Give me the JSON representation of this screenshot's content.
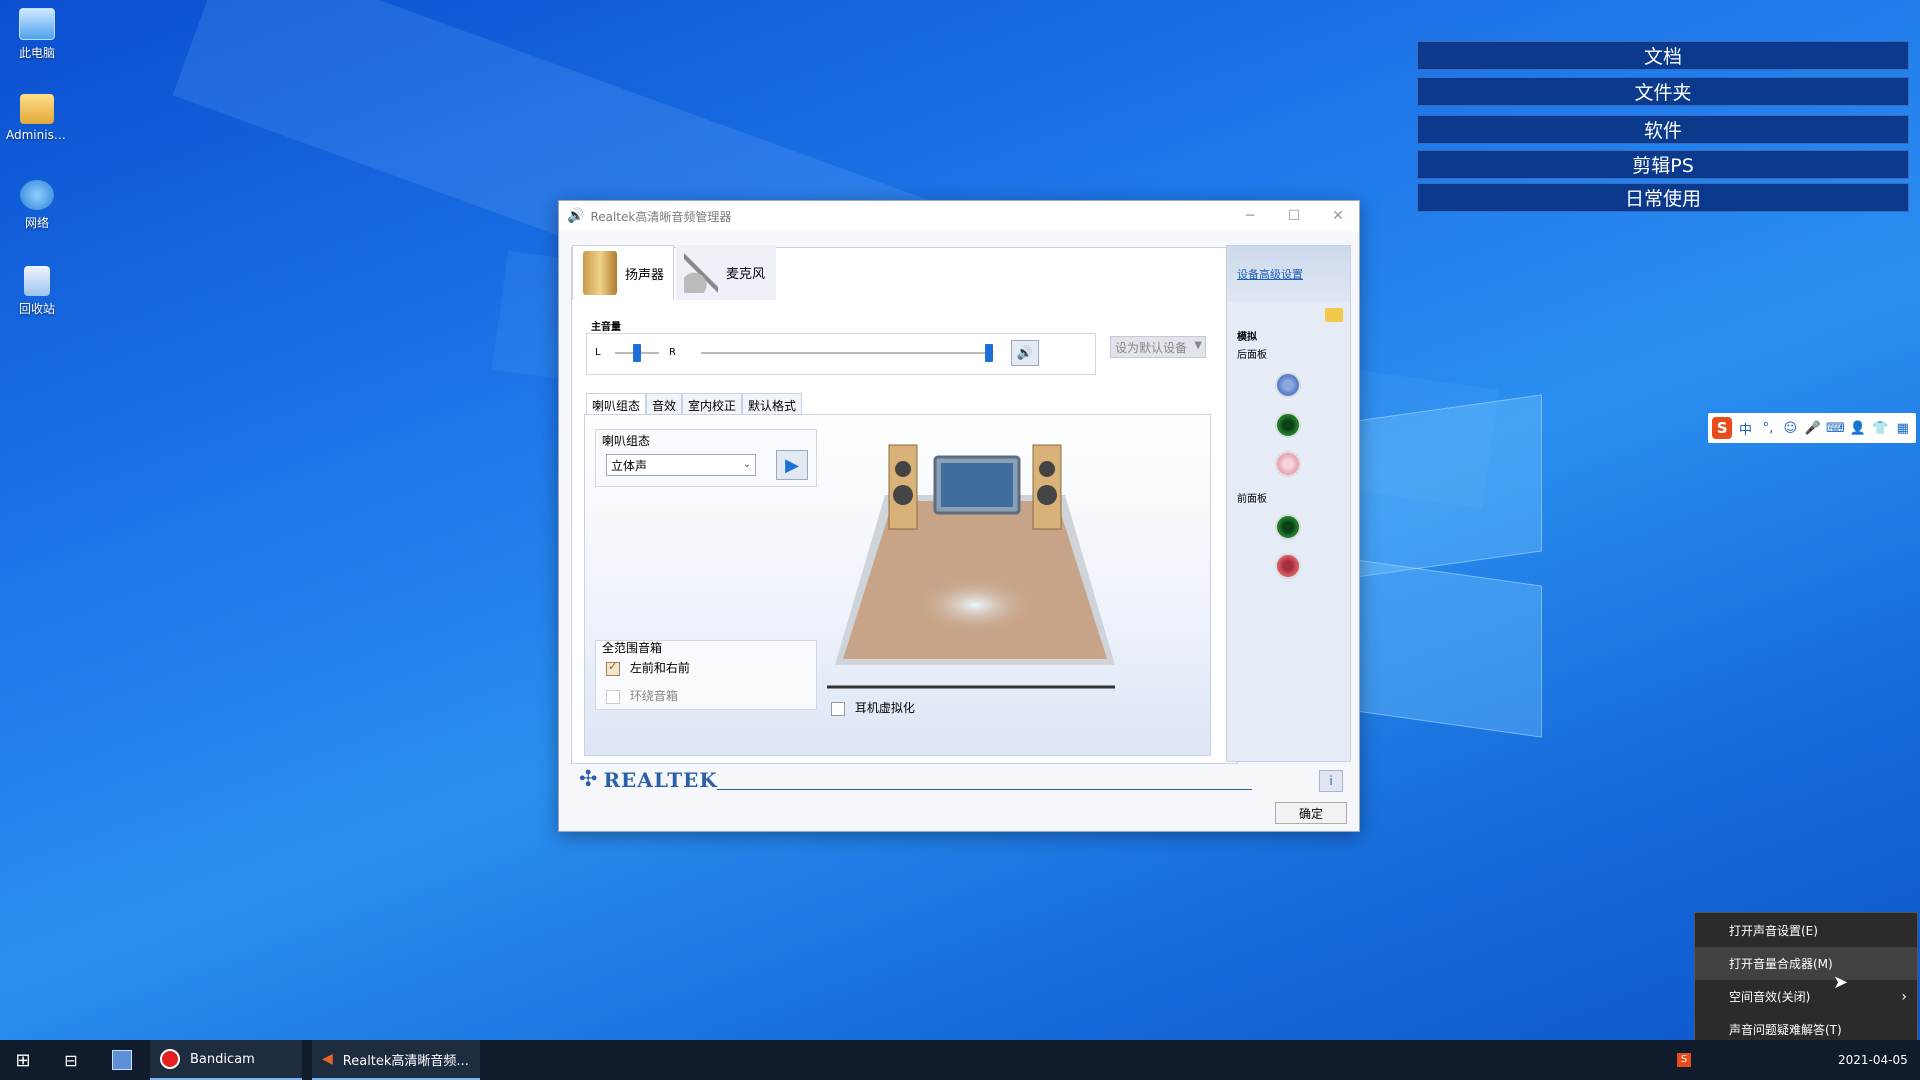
{
  "desktop": {
    "icons": [
      {
        "label": "此电脑",
        "icon": "computer-icon"
      },
      {
        "label": "Administr...",
        "icon": "user-folder-icon"
      },
      {
        "label": "网络",
        "icon": "network-icon"
      },
      {
        "label": "回收站",
        "icon": "recycle-bin-icon"
      }
    ],
    "fences": [
      "文档",
      "文件夹",
      "软件",
      "剪辑PS",
      "日常使用"
    ]
  },
  "ime": {
    "logo": "S",
    "items": [
      "中",
      "°,",
      "☺",
      "🎤",
      "⌨",
      "👤",
      "👕",
      "▦"
    ]
  },
  "realtek": {
    "title": "Realtek高清晰音频管理器",
    "device_tabs": [
      "扬声器",
      "麦克风"
    ],
    "main_volume_label": "主音量",
    "balance_left": "L",
    "balance_right": "R",
    "default_device_label": "设为默认设备",
    "sub_tabs": [
      "喇叭组态",
      "音效",
      "室内校正",
      "默认格式"
    ],
    "speaker_config_label": "喇叭组态",
    "speaker_config_value": "立体声",
    "full_range_label": "全范围音箱",
    "checkbox_front": {
      "label": "左前和右前",
      "checked": true
    },
    "checkbox_surround": {
      "label": "环绕音箱",
      "checked": false,
      "disabled": true
    },
    "headphone_virtualization": {
      "label": "耳机虚拟化",
      "checked": false
    },
    "advanced_link": "设备高级设置",
    "analog_label": "模拟",
    "rear_panel_label": "后面板",
    "front_panel_label": "前面板",
    "brand": "REALTEK",
    "ok_button": "确定",
    "jack_colors": {
      "blue": "#5b7fc9",
      "green": "#1f7a2a",
      "pink": "#e7a6b4",
      "red": "#cf5a66"
    }
  },
  "context_menu": {
    "items": [
      {
        "label": "打开声音设置(E)",
        "has_submenu": false
      },
      {
        "label": "打开音量合成器(M)",
        "has_submenu": false,
        "hover": true
      },
      {
        "label": "空间音效(关闭)",
        "has_submenu": true
      },
      {
        "label": "声音问题疑难解答(T)",
        "has_submenu": false
      }
    ]
  },
  "taskbar": {
    "apps": [
      {
        "label": "Bandicam",
        "icon": "bandicam-record-icon"
      },
      {
        "label": "Realtek高清晰音频...",
        "icon": "speaker-icon"
      }
    ],
    "date": "2021-04-05"
  }
}
